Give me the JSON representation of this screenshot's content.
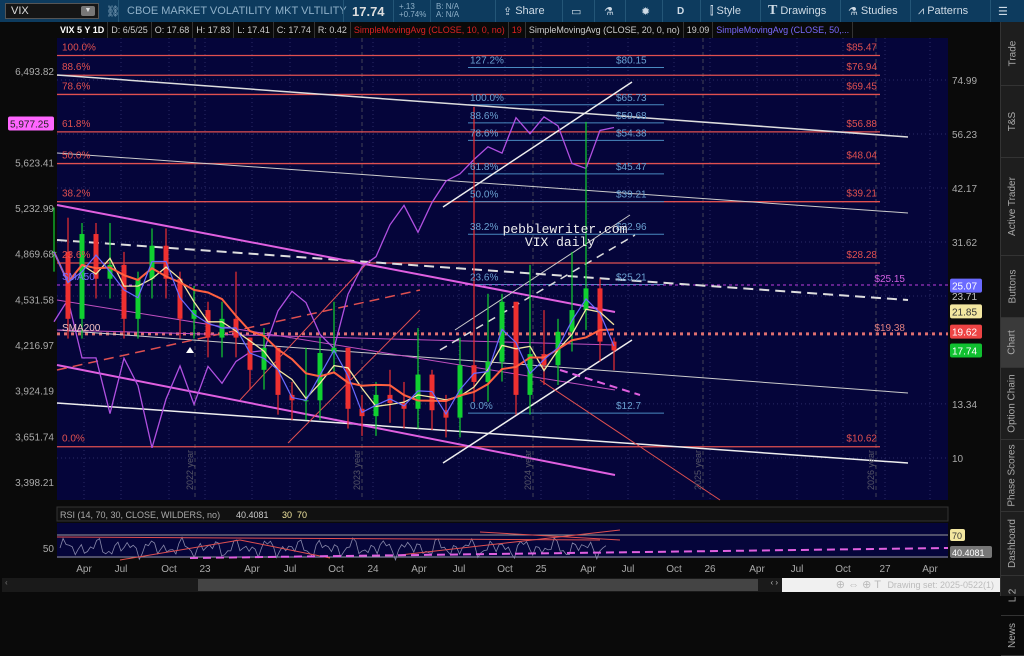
{
  "toolbar": {
    "symbol": "VIX",
    "description": "CBOE MARKET VOLATILITY",
    "exchange_desc": "MKT VLTILITY",
    "last": "17.74",
    "change": "+.13",
    "change_pct": "+0.74%",
    "bid": "B: N/A",
    "ask": "A: N/A",
    "share": "Share",
    "timeframe": "D",
    "style": "Style",
    "drawings": "Drawings",
    "studies": "Studies",
    "patterns": "Patterns"
  },
  "info": {
    "title": "VIX 5 Y 1D",
    "date": "D: 6/5/25",
    "open": "O: 17.68",
    "high": "H: 17.83",
    "low": "L: 17.41",
    "close": "C: 17.74",
    "range": "R: 0.42",
    "sma10": "SimpleMovingAvg (CLOSE, 10, 0, no)",
    "sma10_val": "19",
    "sma20": "SimpleMovingAvg (CLOSE, 20, 0, no)",
    "sma20_val": "19.09",
    "sma50": "SimpleMovingAvg (CLOSE, 50,..."
  },
  "sidebar": [
    "Trade",
    "T&S",
    "Active Trader",
    "Buttons",
    "Chart",
    "Option Chain",
    "Phase Scores",
    "Dashboard",
    "L 2",
    "News"
  ],
  "chart_data": {
    "type": "line",
    "right_axis_ticks": [
      "74.99",
      "56.23",
      "42.17",
      "31.62",
      "23.71",
      "13.34",
      "10"
    ],
    "left_axis_ticks": [
      "6,493.82",
      "5,623.41",
      "5,232.99",
      "4,869.68",
      "4,531.58",
      "4,216.97",
      "3,924.19",
      "3,651.74",
      "3,398.21"
    ],
    "left_axis_values": [
      6493.82,
      5623.41,
      5232.99,
      4869.68,
      4531.58,
      4216.97,
      3924.19,
      3651.74,
      3398.21
    ],
    "right_axis_values": [
      74.99,
      56.23,
      42.17,
      31.62,
      23.71,
      13.34,
      10
    ],
    "scale": "log",
    "x_ticks": [
      "Apr",
      "Jul",
      "Oct",
      "23",
      "Apr",
      "Jul",
      "Oct",
      "24",
      "Apr",
      "Jul",
      "Oct",
      "25",
      "Apr",
      "Jul",
      "Oct",
      "26",
      "Apr",
      "Jul",
      "Oct",
      "27",
      "Apr"
    ],
    "year_labels": [
      "2022 year",
      "2023 year",
      "2024 year",
      "2025 year",
      "2026 year"
    ],
    "months": [
      "2022-02",
      "2022-03",
      "2022-04",
      "2022-05",
      "2022-06",
      "2022-07",
      "2022-08",
      "2022-09",
      "2022-10",
      "2022-11",
      "2022-12",
      "2023-01",
      "2023-02",
      "2023-03",
      "2023-04",
      "2023-05",
      "2023-06",
      "2023-07",
      "2023-08",
      "2023-09",
      "2023-10",
      "2023-11",
      "2023-12",
      "2024-01",
      "2024-02",
      "2024-03",
      "2024-04",
      "2024-05",
      "2024-06",
      "2024-07",
      "2024-08",
      "2024-09",
      "2024-10",
      "2024-11",
      "2024-12",
      "2025-01",
      "2025-02",
      "2025-03",
      "2025-04",
      "2025-05",
      "2025-06"
    ],
    "vix_close": [
      30,
      21,
      33,
      26,
      28,
      21,
      26,
      31,
      26,
      21,
      22,
      19,
      21,
      19,
      16,
      18,
      14,
      13.6,
      13.6,
      17.5,
      18,
      13,
      12.5,
      14,
      13.4,
      13,
      15.6,
      12.9,
      12.4,
      16.4,
      15,
      16.7,
      23,
      14,
      17.4,
      16.4,
      19.6,
      22,
      24.7,
      18.6,
      17.74
    ],
    "vix_high": [
      38,
      36,
      35,
      35,
      35,
      30,
      27,
      34,
      34,
      27,
      25,
      23,
      23,
      27,
      19,
      20,
      18,
      15,
      18,
      19,
      23,
      15,
      14,
      15,
      16,
      15,
      20,
      16,
      14,
      19,
      65,
      24,
      24,
      22,
      28,
      22,
      21,
      30,
      60,
      26,
      19
    ],
    "spx_close": [
      4374,
      4530,
      4132,
      4132,
      3785,
      4130,
      3955,
      3586,
      3872,
      4080,
      3840,
      4077,
      3970,
      4109,
      4169,
      4180,
      4450,
      4589,
      4508,
      4288,
      4194,
      4568,
      4770,
      4846,
      5096,
      5254,
      5036,
      5278,
      5460,
      5522,
      5648,
      5762,
      5705,
      6032,
      5882,
      6040,
      5955,
      5612,
      5569,
      5912,
      5940
    ],
    "fib_right": [
      {
        "pct": "100.0%",
        "price": "$85.47",
        "v": 85.47
      },
      {
        "pct": "88.6%",
        "price": "$76.94",
        "v": 76.94
      },
      {
        "pct": "78.6%",
        "price": "$69.45",
        "v": 69.45
      },
      {
        "pct": "61.8%",
        "price": "$56.88",
        "v": 56.88
      },
      {
        "pct": "50.0%",
        "price": "$48.04",
        "v": 48.04
      },
      {
        "pct": "38.2%",
        "price": "$39.21",
        "v": 39.21
      },
      {
        "pct": "23.6%",
        "price": "$28.28",
        "v": 28.28
      },
      {
        "pct": "0.0%",
        "price": "$10.62",
        "v": 10.62
      }
    ],
    "fib_mid": [
      {
        "pct": "127.2%",
        "price": "$80.15",
        "v": 80.15
      },
      {
        "pct": "100.0%",
        "price": "$65.73",
        "v": 65.73
      },
      {
        "pct": "88.6%",
        "price": "$59.68",
        "v": 59.68
      },
      {
        "pct": "78.6%",
        "price": "$54.38",
        "v": 54.38
      },
      {
        "pct": "61.8%",
        "price": "$45.47",
        "v": 45.47
      },
      {
        "pct": "50.0%",
        "price": "$39.21",
        "v": 39.21
      },
      {
        "pct": "38.2%",
        "price": "$32.96",
        "v": 32.96
      },
      {
        "pct": "23.6%",
        "price": "$25.21",
        "v": 25.21
      },
      {
        "pct": "0.0%",
        "price": "$12.7",
        "v": 12.7
      }
    ],
    "levels": {
      "magenta": {
        "label": "$25.15",
        "v": 25.15
      },
      "red_dotted": {
        "label": "$19.38",
        "v": 19.38
      }
    },
    "price_tags": [
      {
        "label": "25.07",
        "v": 25.07,
        "color": "#6a6aff"
      },
      {
        "label": "21.85",
        "v": 21.85,
        "color": "#f3e7a0"
      },
      {
        "label": "19.62",
        "v": 19.62,
        "color": "#ee4444"
      },
      {
        "label": "17.74",
        "v": 17.74,
        "color": "#10c030"
      }
    ],
    "left_tag": {
      "label": "5,977.25",
      "v": 5977.25,
      "color": "#ff66ff"
    },
    "annotation": [
      "pebblewriter.com",
      "VIX daily"
    ],
    "ma_labels": [
      "SMA50",
      "SMA200"
    ]
  },
  "rsi": {
    "header": "RSI (14, 70, 30, CLOSE, WILDERS, no)",
    "value": "40.4081",
    "lower": "30",
    "upper": "70",
    "mid_label": "50",
    "tag_upper": "70",
    "tag_value": "40.4081"
  },
  "footer": {
    "drawing_set": "Drawing set: 2025-0522(1)"
  }
}
